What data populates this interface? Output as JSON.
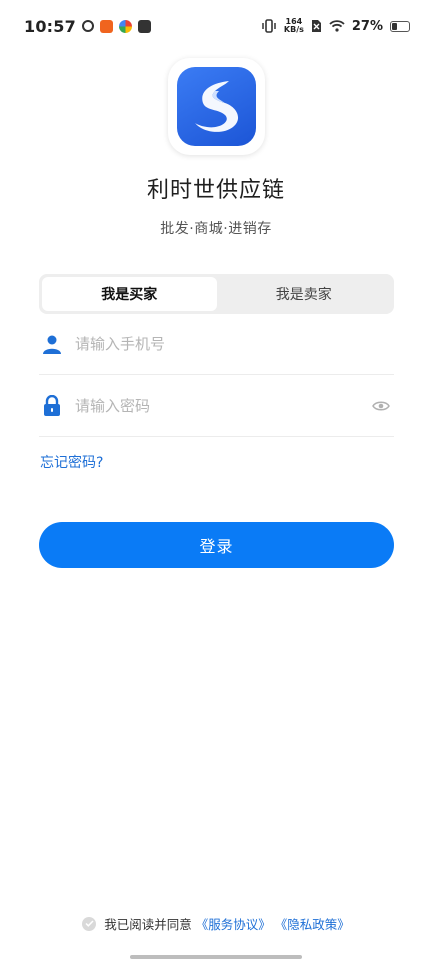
{
  "status_bar": {
    "time": "10:57",
    "net_speed_value": "164",
    "net_speed_unit": "KB/s",
    "battery": "27%"
  },
  "app": {
    "name": "利时世供应链",
    "slogan": "批发·商城·进销存"
  },
  "tabs": [
    {
      "label": "我是买家",
      "active": true
    },
    {
      "label": "我是卖家",
      "active": false
    }
  ],
  "form": {
    "phone_placeholder": "请输入手机号",
    "password_placeholder": "请输入密码",
    "forgot_label": "忘记密码?",
    "login_label": "登录"
  },
  "agreement": {
    "prefix": "我已阅读并同意",
    "service_link": "《服务协议》",
    "privacy_link": "《隐私政策》"
  },
  "colors": {
    "primary": "#0a7bf6",
    "link": "#1e6fd6",
    "logo_blue": "#1c55d6"
  },
  "icons": {
    "phone_field": "user-icon",
    "password_field": "lock-icon",
    "toggle_password": "eye-icon",
    "agreement_check": "check-circle-icon"
  }
}
